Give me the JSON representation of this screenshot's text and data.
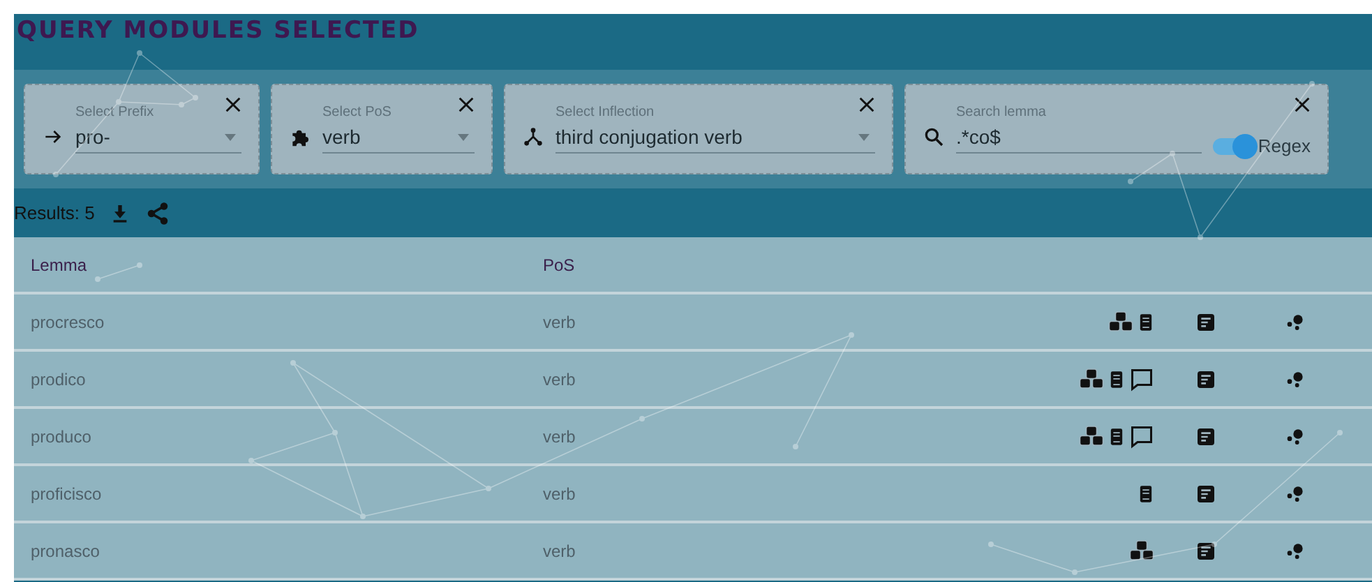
{
  "title": "QUERY MODULES SELECTED",
  "filters": [
    {
      "kind": "select",
      "label": "Select Prefix",
      "value": "pro-"
    },
    {
      "kind": "select",
      "label": "Select PoS",
      "value": "verb"
    },
    {
      "kind": "select",
      "label": "Select Inflection",
      "value": "third conjugation verb"
    },
    {
      "kind": "search",
      "label": "Search lemma",
      "value": ".*co$",
      "toggle": {
        "label": "Regex",
        "on": true
      }
    }
  ],
  "results": {
    "label": "Results: 5"
  },
  "table": {
    "columns": [
      "Lemma",
      "PoS"
    ],
    "rows": [
      {
        "lemma": "procresco",
        "pos": "verb",
        "has_cubes": true,
        "has_book": true,
        "has_comment": false
      },
      {
        "lemma": "prodico",
        "pos": "verb",
        "has_cubes": true,
        "has_book": true,
        "has_comment": true
      },
      {
        "lemma": "produco",
        "pos": "verb",
        "has_cubes": true,
        "has_book": true,
        "has_comment": true
      },
      {
        "lemma": "proficisco",
        "pos": "verb",
        "has_cubes": false,
        "has_book": true,
        "has_comment": false
      },
      {
        "lemma": "pronasco",
        "pos": "verb",
        "has_cubes": true,
        "has_book": false,
        "has_comment": false
      }
    ]
  }
}
